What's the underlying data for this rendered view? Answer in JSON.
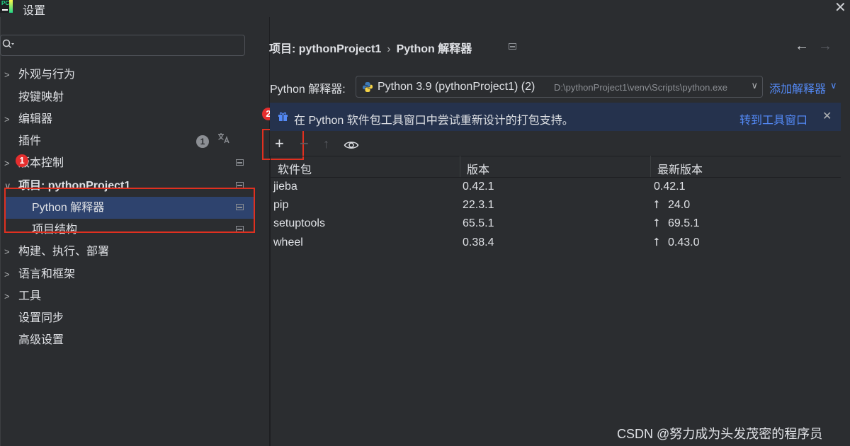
{
  "window": {
    "title": "设置",
    "close": "✕"
  },
  "sidebar": {
    "search_placeholder": "",
    "items": [
      {
        "label": "外观与行为"
      },
      {
        "label": "按键映射"
      },
      {
        "label": "编辑器"
      },
      {
        "label": "插件",
        "badge": "1"
      },
      {
        "label": "版本控制"
      },
      {
        "label": "项目: pythonProject1"
      },
      {
        "label": "Python 解释器"
      },
      {
        "label": "项目结构"
      },
      {
        "label": "构建、执行、部署"
      },
      {
        "label": "语言和框架"
      },
      {
        "label": "工具"
      },
      {
        "label": "设置同步"
      },
      {
        "label": "高级设置"
      }
    ]
  },
  "callouts": {
    "one": "1",
    "two": "2"
  },
  "breadcrumb": {
    "project": "项目: pythonProject1",
    "sep": "›",
    "page": "Python 解释器"
  },
  "interpreter": {
    "label": "Python 解释器:",
    "name": "Python 3.9 (pythonProject1) (2)",
    "path": "D:\\pythonProject1\\venv\\Scripts\\python.exe",
    "add_label": "添加解释器",
    "add_chevron": "∨"
  },
  "banner": {
    "text": "在 Python 软件包工具窗口中尝试重新设计的打包支持。",
    "link": "转到工具窗口",
    "close": "✕"
  },
  "toolbar": {
    "add": "+",
    "remove": "−",
    "upgrade": "↑"
  },
  "table": {
    "headers": [
      "软件包",
      "版本",
      "最新版本"
    ],
    "rows": [
      {
        "package": "jieba",
        "version": "0.42.1",
        "latest": "0.42.1",
        "upgradable": false
      },
      {
        "package": "pip",
        "version": "22.3.1",
        "latest": "24.0",
        "upgradable": true
      },
      {
        "package": "setuptools",
        "version": "65.5.1",
        "latest": "69.5.1",
        "upgradable": true
      },
      {
        "package": "wheel",
        "version": "0.38.4",
        "latest": "0.43.0",
        "upgradable": true
      }
    ]
  },
  "watermark": "CSDN @努力成为头发茂密的程序员",
  "colors": {
    "accent": "#548af7",
    "selection": "#2e436e",
    "highlight": "#e03020",
    "callout": "#e52e2e",
    "banner": "#25324d"
  }
}
